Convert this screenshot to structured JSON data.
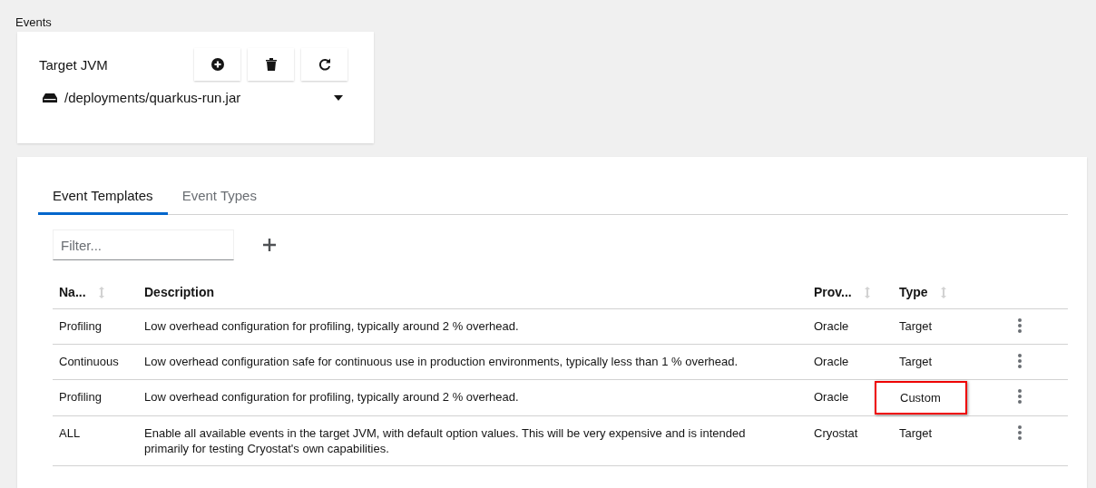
{
  "page_title": "Events",
  "target": {
    "label": "Target JVM",
    "selected_jvm": "/deployments/quarkus-run.jar"
  },
  "tabs": [
    {
      "label": "Event Templates",
      "selected": true
    },
    {
      "label": "Event Types",
      "selected": false
    }
  ],
  "filter": {
    "placeholder": "Filter..."
  },
  "table": {
    "columns": [
      {
        "label": "Na...",
        "sortable": true
      },
      {
        "label": "Description",
        "sortable": false
      },
      {
        "label": "Prov...",
        "sortable": true
      },
      {
        "label": "Type",
        "sortable": true
      }
    ],
    "rows": [
      {
        "name": "Profiling",
        "description": "Low overhead configuration for profiling, typically around 2 % overhead.",
        "provider": "Oracle",
        "type": "Target",
        "highlighted": false
      },
      {
        "name": "Continuous",
        "description": "Low overhead configuration safe for continuous use in production environments, typically less than 1 % overhead.",
        "provider": "Oracle",
        "type": "Target",
        "highlighted": false
      },
      {
        "name": "Profiling",
        "description": "Low overhead configuration for profiling, typically around 2 % overhead.",
        "provider": "Oracle",
        "type": "Custom",
        "highlighted": true
      },
      {
        "name": "ALL",
        "description": "Enable all available events in the target JVM, with default option values. This will be very expensive and is intended primarily for testing Cryostat's own capabilities.",
        "provider": "Cryostat",
        "type": "Target",
        "highlighted": false
      }
    ]
  }
}
